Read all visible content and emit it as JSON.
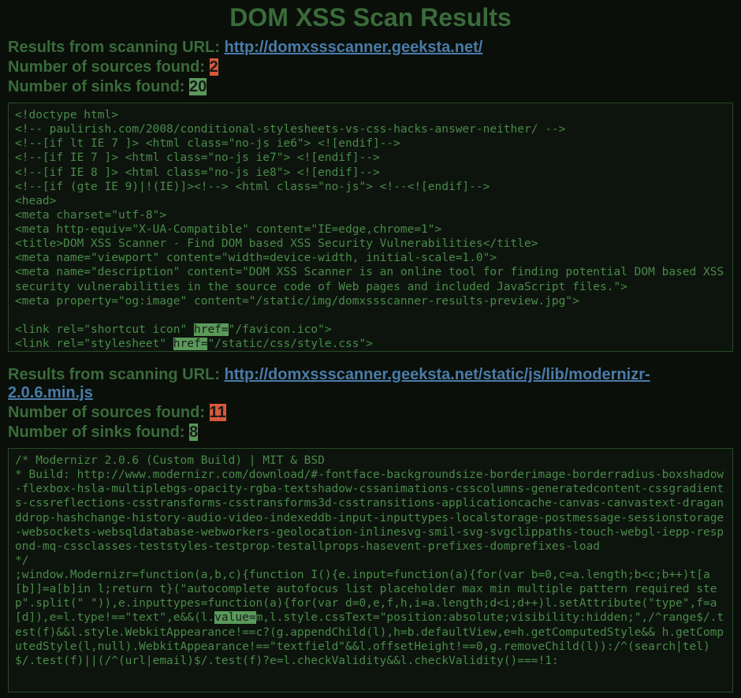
{
  "title": "DOM XSS Scan Results",
  "sections": [
    {
      "label_url": "Results from scanning URL: ",
      "url": "http://domxssscanner.geeksta.net/",
      "label_sources": "Number of sources found: ",
      "sources": "2",
      "label_sinks": "Number of sinks found: ",
      "sinks": "20",
      "code_tokens": [
        {
          "t": "<!doctype html>\n<!-- paulirish.com/2008/conditional-stylesheets-vs-css-hacks-answer-neither/ -->\n<!--[if lt IE 7 ]> <html class=\"no-js ie6\"> <![endif]-->\n<!--[if IE 7 ]> <html class=\"no-js ie7\"> <![endif]-->\n<!--[if IE 8 ]> <html class=\"no-js ie8\"> <![endif]-->\n<!--[if (gte IE 9)|!(IE)]><!--> <html class=\"no-js\"> <!--<![endif]-->\n<head>\n<meta charset=\"utf-8\">\n<meta http-equiv=\"X-UA-Compatible\" content=\"IE=edge,chrome=1\">\n<title>DOM XSS Scanner - Find DOM based XSS Security Vulnerabilities</title>\n<meta name=\"viewport\" content=\"width=device-width, initial-scale=1.0\">\n<meta name=\"description\" content=\"DOM XSS Scanner is an online tool for finding potential DOM based XSS security vulnerabilities in the source code of Web pages and included JavaScript files.\">\n<meta property=\"og:image\" content=\"/static/img/domxssscanner-results-preview.jpg\">\n\n<link rel=\"shortcut icon\" "
        },
        {
          "t": "href=",
          "c": "hl-sink"
        },
        {
          "t": "\"/favicon.ico\">\n<link rel=\"stylesheet\" "
        },
        {
          "t": "href=",
          "c": "hl-sink"
        },
        {
          "t": "\"/static/css/style.css\">"
        }
      ]
    },
    {
      "label_url": "Results from scanning URL: ",
      "url": "http://domxssscanner.geeksta.net/static/js/lib/modernizr-2.0.6.min.js",
      "label_sources": "Number of sources found: ",
      "sources": "11",
      "label_sinks": "Number of sinks found: ",
      "sinks": "8",
      "code_tokens": [
        {
          "t": "/* Modernizr 2.0.6 (Custom Build) | MIT & BSD\n* Build: http://www.modernizr.com/download/#-fontface-backgroundsize-borderimage-borderradius-boxshadow-flexbox-hsla-multiplebgs-opacity-rgba-textshadow-cssanimations-csscolumns-generatedcontent-cssgradients-cssreflections-csstransforms-csstransforms3d-csstransitions-applicationcache-canvas-canvastext-draganddrop-hashchange-history-audio-video-indexeddb-input-inputtypes-localstorage-postmessage-sessionstorage-websockets-websqldatabase-webworkers-geolocation-inlinesvg-smil-svg-svgclippaths-touch-webgl-iepp-respond-mq-cssclasses-teststyles-testprop-testallprops-hasevent-prefixes-domprefixes-load\n*/\n;window.Modernizr=function(a,b,c){function I(){e.input=function(a){for(var b=0,c=a.length;b<c;b++)t[a[b]]=a[b]in l;return t}(\"autocomplete autofocus list placeholder max min multiple pattern required step\".split(\" \")),e.inputtypes=function(a){for(var d=0,e,f,h,i=a.length;d<i;d++)l.setAttribute(\"type\",f=a[d]),e=l.type!==\"text\",e&&(l."
        },
        {
          "t": "value=",
          "c": "hl-sink"
        },
        {
          "t": "m,l.style.cssText=\"position:absolute;visibility:hidden;\",/^range$/.test(f)&&l.style.WebkitAppearance!==c?(g.appendChild(l),h=b.defaultView,e=h.getComputedStyle&& h.getComputedStyle(l,null).WebkitAppearance!==\"textfield\"&&l.offsetHeight!==0,g.removeChild(l)):/^(search|tel)$/.test(f)||(/^(url|email)$/.test(f)?e=l.checkValidity&&l.checkValidity()===!1:"
        }
      ]
    }
  ]
}
